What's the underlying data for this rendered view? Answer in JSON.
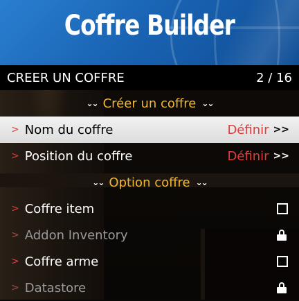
{
  "banner": {
    "title": "Coffre Builder"
  },
  "subtitle": {
    "text": "CREER UN COFFRE",
    "counter": "2 / 16"
  },
  "colors": {
    "banner_blue": "#1a64b4",
    "section_gold": "#f3b82a",
    "accent_red": "#e23c3c"
  },
  "sections": [
    {
      "label": "Créer un coffre",
      "icon": "double-chevron-down-icon"
    },
    {
      "label": "Option coffre",
      "icon": "double-chevron-down-icon"
    }
  ],
  "items": [
    {
      "prefix": ">",
      "label": "Nom du coffre",
      "value": "Définir",
      "chevrons": ">>",
      "selected": true
    },
    {
      "prefix": ">",
      "label": "Position du coffre",
      "value": "Définir",
      "chevrons": ">>"
    },
    {
      "prefix": ">",
      "label": "Coffre item",
      "control": "checkbox-icon"
    },
    {
      "prefix": ">",
      "label": "Addon Inventory",
      "control": "lock-icon",
      "disabled": true
    },
    {
      "prefix": ">",
      "label": "Coffre arme",
      "control": "checkbox-icon"
    },
    {
      "prefix": ">",
      "label": "Datastore",
      "control": "lock-icon",
      "disabled": true
    }
  ]
}
